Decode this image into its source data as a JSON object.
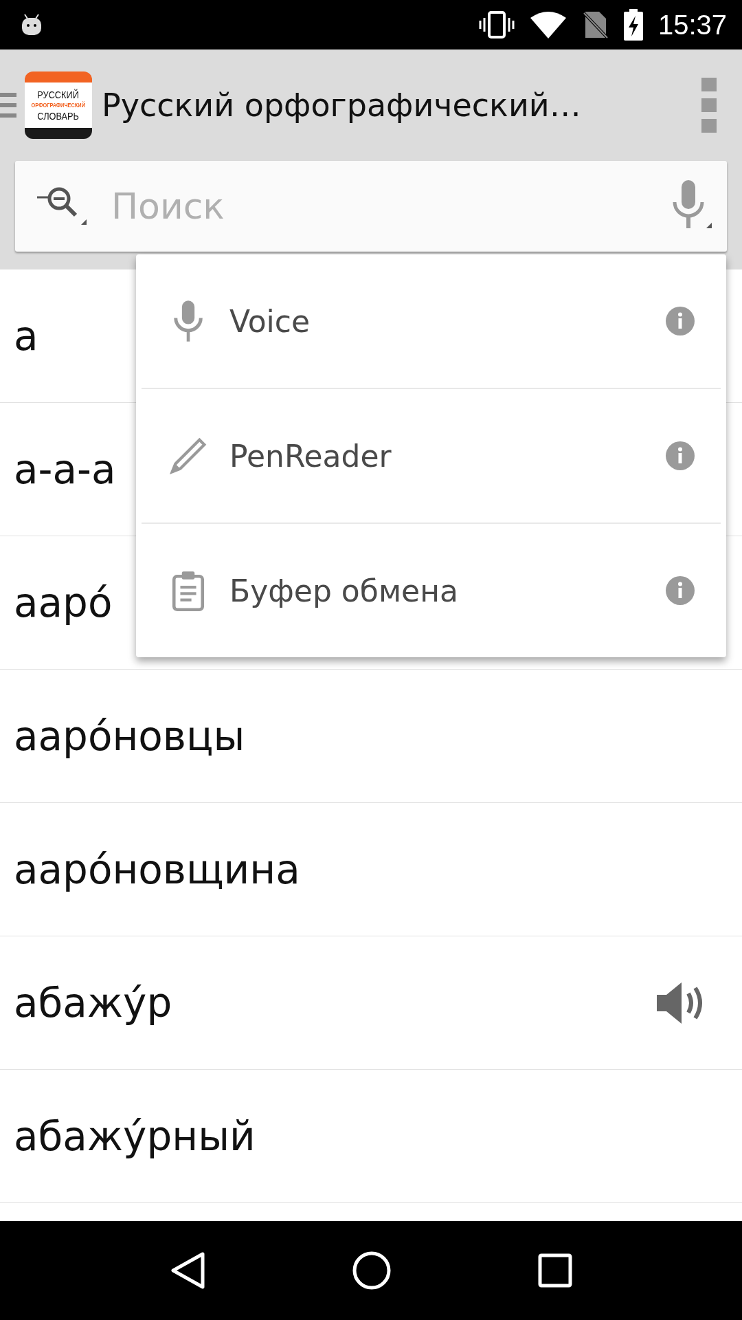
{
  "status_bar": {
    "time": "15:37"
  },
  "app_bar": {
    "logo_lines": [
      {
        "text": "РУССКИЙ",
        "accent": false
      },
      {
        "text": "ОРФОГРАФИЧЕСКИЙ",
        "accent": true
      },
      {
        "text": "СЛОВАРЬ",
        "accent": false
      }
    ],
    "title": "Русский орфографический…"
  },
  "search": {
    "placeholder": "Поиск"
  },
  "words": [
    {
      "text": "а",
      "audio": false
    },
    {
      "text": "а-а-а",
      "audio": false
    },
    {
      "text": "аарó",
      "audio": false
    },
    {
      "text": "аарóновцы",
      "audio": false
    },
    {
      "text": "аарóновщина",
      "audio": false
    },
    {
      "text": "абажу́р",
      "audio": true
    },
    {
      "text": "абажу́рный",
      "audio": false
    }
  ],
  "input_menu": [
    {
      "kind": "voice",
      "label": "Voice"
    },
    {
      "kind": "pen",
      "label": "PenReader"
    },
    {
      "kind": "clipboard",
      "label": "Буфер обмена"
    }
  ]
}
